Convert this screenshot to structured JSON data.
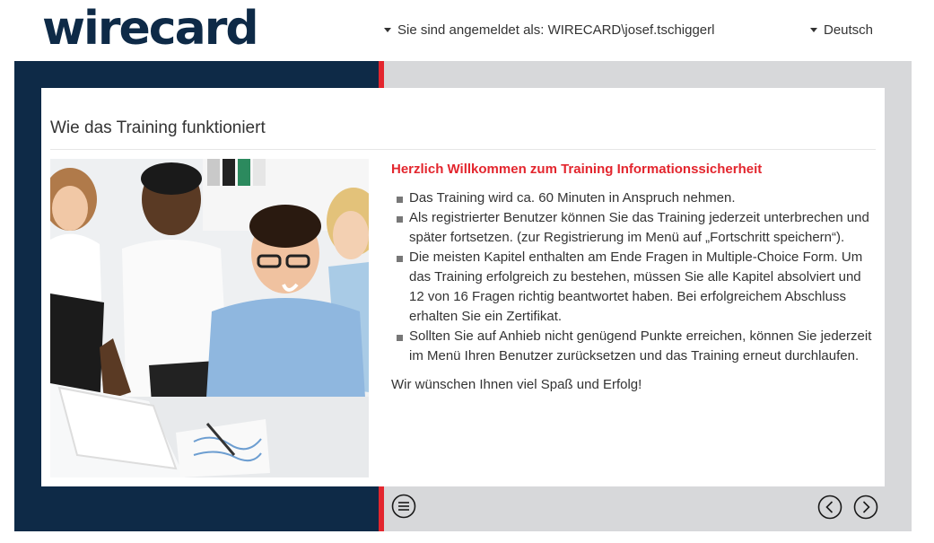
{
  "header": {
    "logo_text": "wirecard",
    "logo_color": "#0e2a47",
    "login_label": "Sie sind angemeldet als: WIRECARD\\josef.tschiggerl",
    "language_label": "Deutsch"
  },
  "colors": {
    "navy": "#0e2a47",
    "accent_red": "#e3262e",
    "panel_gray": "#d7d8da"
  },
  "main": {
    "title": "Wie das Training funktioniert",
    "welcome_heading": "Herzlich Willkommen zum Training Informationssicherheit",
    "bullets": [
      "Das Training wird ca. 60 Minuten in Anspruch nehmen.",
      "Als registrierter Benutzer können Sie das Training jederzeit unterbrechen und später fortsetzen. (zur Registrierung im Menü auf „Fortschritt speichern“).",
      "Die meisten Kapitel enthalten am Ende Fragen in Multiple-Choice Form. Um das Training erfolgreich zu bestehen, müssen Sie alle Kapitel absolviert und 12 von 16 Fragen richtig beantwortet haben. Bei erfolgreichem Abschluss erhalten Sie ein Zertifikat.",
      "Sollten Sie auf Anhieb nicht genügend Punkte erreichen, können Sie jederzeit im Menü Ihren Benutzer zurücksetzen und das Training erneut durchlaufen."
    ],
    "closing": "Wir wünschen Ihnen viel Spaß und Erfolg!"
  },
  "footer": {
    "menu_icon": "hamburger-circle-icon",
    "prev_icon": "chevron-left-circle-icon",
    "next_icon": "chevron-right-circle-icon"
  }
}
